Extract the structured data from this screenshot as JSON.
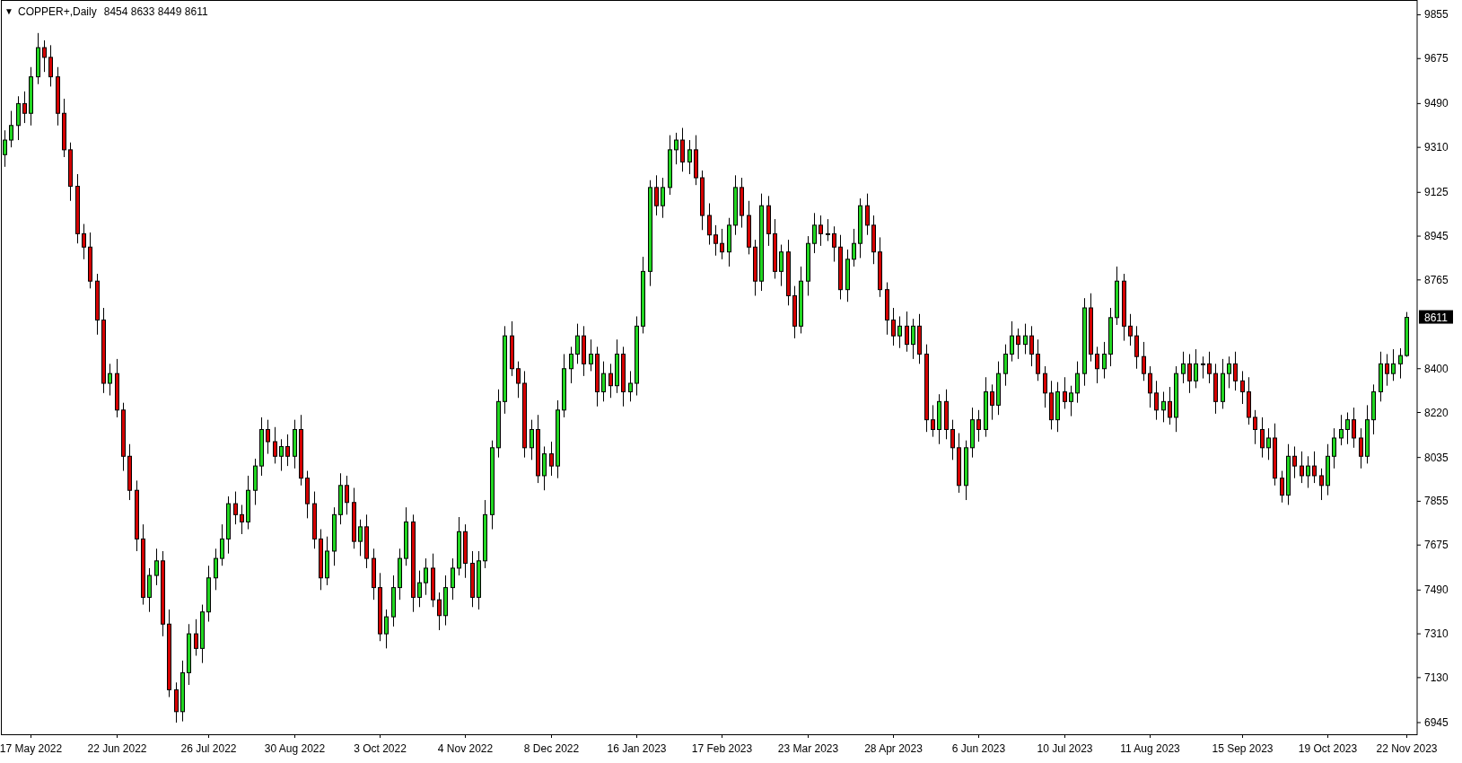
{
  "header": {
    "menu_glyph": "▼",
    "symbol": "COPPER+,Daily",
    "ohlc": [
      "8454",
      "8633",
      "8449",
      "8611"
    ]
  },
  "current_price_label": "8611",
  "chart_data": {
    "type": "candlestick",
    "ylim": [
      6897,
      9914
    ],
    "yticks": [
      {
        "value": 9855,
        "label": "9855"
      },
      {
        "value": 9675,
        "label": "9675"
      },
      {
        "value": 9490,
        "label": "9490"
      },
      {
        "value": 9310,
        "label": "9310"
      },
      {
        "value": 9125,
        "label": "9125"
      },
      {
        "value": 8945,
        "label": "8945"
      },
      {
        "value": 8765,
        "label": "8765"
      },
      {
        "value": 8400,
        "label": "8400"
      },
      {
        "value": 8220,
        "label": "8220"
      },
      {
        "value": 8035,
        "label": "8035"
      },
      {
        "value": 7855,
        "label": "7855"
      },
      {
        "value": 7675,
        "label": "7675"
      },
      {
        "value": 7490,
        "label": "7490"
      },
      {
        "value": 7310,
        "label": "7310"
      },
      {
        "value": 7130,
        "label": "7130"
      },
      {
        "value": 6945,
        "label": "6945"
      }
    ],
    "categories": [
      null,
      null,
      null,
      null,
      "17 May 2022",
      null,
      null,
      null,
      null,
      null,
      null,
      null,
      null,
      null,
      null,
      null,
      null,
      "22 Jun 2022",
      null,
      null,
      null,
      null,
      null,
      null,
      null,
      null,
      null,
      null,
      null,
      null,
      null,
      "26 Jul 2022",
      null,
      null,
      null,
      null,
      null,
      null,
      null,
      null,
      null,
      null,
      null,
      null,
      "30 Aug 2022",
      null,
      null,
      null,
      null,
      null,
      null,
      null,
      null,
      null,
      null,
      null,
      null,
      "3 Oct 2022",
      null,
      null,
      null,
      null,
      null,
      null,
      null,
      null,
      null,
      null,
      null,
      null,
      "4 Nov 2022",
      null,
      null,
      null,
      null,
      null,
      null,
      null,
      null,
      null,
      null,
      null,
      null,
      "8 Dec 2022",
      null,
      null,
      null,
      null,
      null,
      null,
      null,
      null,
      null,
      null,
      null,
      null,
      "16 Jan 2023",
      null,
      null,
      null,
      null,
      null,
      null,
      null,
      null,
      null,
      null,
      null,
      null,
      "17 Feb 2023",
      null,
      null,
      null,
      null,
      null,
      null,
      null,
      null,
      null,
      null,
      null,
      null,
      "23 Mar 2023",
      null,
      null,
      null,
      null,
      null,
      null,
      null,
      null,
      null,
      null,
      null,
      null,
      "28 Apr 2023",
      null,
      null,
      null,
      null,
      null,
      null,
      null,
      null,
      null,
      null,
      null,
      null,
      "6 Jun 2023",
      null,
      null,
      null,
      null,
      null,
      null,
      null,
      null,
      null,
      null,
      null,
      null,
      "10 Jul 2023",
      null,
      null,
      null,
      null,
      null,
      null,
      null,
      null,
      null,
      null,
      null,
      null,
      "11 Aug 2023",
      null,
      null,
      null,
      null,
      null,
      null,
      null,
      null,
      null,
      null,
      null,
      null,
      null,
      "15 Sep 2023",
      null,
      null,
      null,
      null,
      null,
      null,
      null,
      null,
      null,
      null,
      null,
      null,
      "19 Oct 2023",
      null,
      null,
      null,
      null,
      null,
      null,
      null,
      null,
      null,
      null,
      null,
      "22 Nov 2023"
    ],
    "ohlc": [
      [
        9280,
        9380,
        9230,
        9340
      ],
      [
        9340,
        9460,
        9310,
        9400
      ],
      [
        9400,
        9520,
        9340,
        9490
      ],
      [
        9490,
        9540,
        9410,
        9450
      ],
      [
        9450,
        9640,
        9400,
        9600
      ],
      [
        9600,
        9780,
        9570,
        9720
      ],
      [
        9720,
        9750,
        9620,
        9680
      ],
      [
        9680,
        9730,
        9560,
        9600
      ],
      [
        9600,
        9640,
        9400,
        9450
      ],
      [
        9450,
        9510,
        9270,
        9300
      ],
      [
        9300,
        9330,
        9090,
        9150
      ],
      [
        9150,
        9200,
        8915,
        8955
      ],
      [
        8955,
        8995,
        8850,
        8900
      ],
      [
        8900,
        8960,
        8730,
        8760
      ],
      [
        8760,
        8790,
        8540,
        8600
      ],
      [
        8600,
        8650,
        8300,
        8340
      ],
      [
        8340,
        8420,
        8290,
        8380
      ],
      [
        8380,
        8440,
        8200,
        8230
      ],
      [
        8230,
        8260,
        7980,
        8040
      ],
      [
        8040,
        8090,
        7860,
        7900
      ],
      [
        7900,
        7940,
        7650,
        7700
      ],
      [
        7700,
        7760,
        7430,
        7460
      ],
      [
        7460,
        7580,
        7400,
        7550
      ],
      [
        7550,
        7660,
        7510,
        7610
      ],
      [
        7610,
        7650,
        7300,
        7350
      ],
      [
        7350,
        7410,
        7050,
        7080
      ],
      [
        7080,
        7110,
        6945,
        6990
      ],
      [
        6990,
        7200,
        6950,
        7150
      ],
      [
        7150,
        7350,
        7100,
        7310
      ],
      [
        7310,
        7370,
        7220,
        7250
      ],
      [
        7250,
        7430,
        7190,
        7400
      ],
      [
        7400,
        7590,
        7360,
        7540
      ],
      [
        7540,
        7660,
        7490,
        7620
      ],
      [
        7620,
        7760,
        7590,
        7700
      ],
      [
        7700,
        7875,
        7640,
        7845
      ],
      [
        7845,
        7895,
        7760,
        7800
      ],
      [
        7800,
        7840,
        7720,
        7770
      ],
      [
        7770,
        7960,
        7740,
        7900
      ],
      [
        7900,
        8030,
        7840,
        8000
      ],
      [
        8000,
        8200,
        7960,
        8150
      ],
      [
        8150,
        8190,
        8050,
        8100
      ],
      [
        8100,
        8160,
        8010,
        8040
      ],
      [
        8040,
        8110,
        7980,
        8080
      ],
      [
        8080,
        8130,
        8000,
        8040
      ],
      [
        8040,
        8190,
        7990,
        8150
      ],
      [
        8150,
        8210,
        7920,
        7950
      ],
      [
        7950,
        7980,
        7785,
        7845
      ],
      [
        7845,
        7895,
        7660,
        7700
      ],
      [
        7700,
        7740,
        7490,
        7540
      ],
      [
        7540,
        7710,
        7510,
        7650
      ],
      [
        7650,
        7830,
        7590,
        7800
      ],
      [
        7800,
        7970,
        7760,
        7920
      ],
      [
        7920,
        7960,
        7800,
        7850
      ],
      [
        7850,
        7910,
        7660,
        7690
      ],
      [
        7690,
        7780,
        7630,
        7750
      ],
      [
        7750,
        7800,
        7580,
        7620
      ],
      [
        7620,
        7660,
        7450,
        7500
      ],
      [
        7500,
        7560,
        7280,
        7310
      ],
      [
        7310,
        7410,
        7250,
        7380
      ],
      [
        7380,
        7550,
        7340,
        7500
      ],
      [
        7500,
        7660,
        7450,
        7620
      ],
      [
        7620,
        7830,
        7590,
        7770
      ],
      [
        7770,
        7800,
        7400,
        7460
      ],
      [
        7460,
        7570,
        7420,
        7520
      ],
      [
        7520,
        7620,
        7470,
        7580
      ],
      [
        7580,
        7640,
        7420,
        7450
      ],
      [
        7450,
        7480,
        7325,
        7385
      ],
      [
        7385,
        7550,
        7345,
        7500
      ],
      [
        7500,
        7620,
        7450,
        7580
      ],
      [
        7580,
        7790,
        7550,
        7730
      ],
      [
        7730,
        7760,
        7540,
        7600
      ],
      [
        7600,
        7650,
        7420,
        7460
      ],
      [
        7460,
        7650,
        7410,
        7610
      ],
      [
        7610,
        7860,
        7580,
        7800
      ],
      [
        7800,
        8105,
        7740,
        8075
      ],
      [
        8075,
        8315,
        8035,
        8265
      ],
      [
        8265,
        8575,
        8215,
        8535
      ],
      [
        8535,
        8595,
        8370,
        8400
      ],
      [
        8400,
        8430,
        8280,
        8340
      ],
      [
        8340,
        8390,
        8035,
        8075
      ],
      [
        8075,
        8190,
        8025,
        8150
      ],
      [
        8150,
        8210,
        7930,
        7960
      ],
      [
        7960,
        8080,
        7900,
        8050
      ],
      [
        8050,
        8100,
        7960,
        8000
      ],
      [
        8000,
        8270,
        7950,
        8230
      ],
      [
        8230,
        8460,
        8200,
        8400
      ],
      [
        8400,
        8490,
        8340,
        8460
      ],
      [
        8460,
        8585,
        8420,
        8535
      ],
      [
        8535,
        8575,
        8370,
        8420
      ],
      [
        8420,
        8520,
        8390,
        8460
      ],
      [
        8460,
        8490,
        8245,
        8305
      ],
      [
        8305,
        8430,
        8265,
        8380
      ],
      [
        8380,
        8420,
        8280,
        8330
      ],
      [
        8330,
        8520,
        8300,
        8460
      ],
      [
        8460,
        8490,
        8245,
        8305
      ],
      [
        8305,
        8390,
        8265,
        8340
      ],
      [
        8340,
        8615,
        8290,
        8575
      ],
      [
        8575,
        8860,
        8545,
        8800
      ],
      [
        8800,
        9175,
        8740,
        9145
      ],
      [
        9145,
        9195,
        9030,
        9070
      ],
      [
        9070,
        9185,
        9020,
        9145
      ],
      [
        9145,
        9360,
        9115,
        9300
      ],
      [
        9300,
        9370,
        9240,
        9340
      ],
      [
        9340,
        9390,
        9210,
        9250
      ],
      [
        9250,
        9340,
        9200,
        9300
      ],
      [
        9300,
        9360,
        9155,
        9185
      ],
      [
        9185,
        9215,
        8970,
        9030
      ],
      [
        9030,
        9080,
        8910,
        8950
      ],
      [
        8950,
        8990,
        8865,
        8915
      ],
      [
        8915,
        8975,
        8850,
        8880
      ],
      [
        8880,
        9020,
        8820,
        8990
      ],
      [
        8990,
        9195,
        8950,
        9145
      ],
      [
        9145,
        9185,
        8980,
        9030
      ],
      [
        9030,
        9090,
        8870,
        8900
      ],
      [
        8900,
        8930,
        8700,
        8760
      ],
      [
        8760,
        9120,
        8720,
        9070
      ],
      [
        9070,
        9110,
        8905,
        8955
      ],
      [
        8955,
        9015,
        8770,
        8800
      ],
      [
        8800,
        8910,
        8740,
        8880
      ],
      [
        8880,
        8930,
        8660,
        8700
      ],
      [
        8700,
        8740,
        8525,
        8575
      ],
      [
        8575,
        8820,
        8545,
        8760
      ],
      [
        8760,
        8945,
        8700,
        8915
      ],
      [
        8915,
        9040,
        8875,
        8990
      ],
      [
        8990,
        9030,
        8905,
        8955
      ],
      [
        8955,
        9015,
        8925,
        8955
      ],
      [
        8955,
        8985,
        8840,
        8900
      ],
      [
        8900,
        8950,
        8685,
        8725
      ],
      [
        8725,
        8890,
        8675,
        8850
      ],
      [
        8850,
        8975,
        8820,
        8915
      ],
      [
        8915,
        9100,
        8855,
        9070
      ],
      [
        9070,
        9120,
        8950,
        8990
      ],
      [
        8990,
        9030,
        8830,
        8880
      ],
      [
        8880,
        8940,
        8695,
        8725
      ],
      [
        8725,
        8755,
        8540,
        8600
      ],
      [
        8600,
        8650,
        8495,
        8535
      ],
      [
        8535,
        8615,
        8485,
        8575
      ],
      [
        8575,
        8635,
        8470,
        8500
      ],
      [
        8500,
        8605,
        8440,
        8575
      ],
      [
        8575,
        8625,
        8420,
        8460
      ],
      [
        8460,
        8500,
        8140,
        8190
      ],
      [
        8190,
        8250,
        8120,
        8150
      ],
      [
        8150,
        8295,
        8090,
        8265
      ],
      [
        8265,
        8315,
        8110,
        8150
      ],
      [
        8150,
        8190,
        8025,
        8075
      ],
      [
        8075,
        8135,
        7890,
        7920
      ],
      [
        7920,
        8105,
        7860,
        8075
      ],
      [
        8075,
        8240,
        8035,
        8190
      ],
      [
        8190,
        8230,
        8100,
        8150
      ],
      [
        8150,
        8365,
        8120,
        8305
      ],
      [
        8305,
        8335,
        8190,
        8250
      ],
      [
        8250,
        8430,
        8210,
        8380
      ],
      [
        8380,
        8500,
        8330,
        8460
      ],
      [
        8460,
        8595,
        8430,
        8535
      ],
      [
        8535,
        8565,
        8440,
        8500
      ],
      [
        8500,
        8585,
        8460,
        8535
      ],
      [
        8535,
        8575,
        8410,
        8460
      ],
      [
        8460,
        8520,
        8350,
        8380
      ],
      [
        8380,
        8410,
        8240,
        8300
      ],
      [
        8300,
        8350,
        8150,
        8190
      ],
      [
        8190,
        8345,
        8140,
        8305
      ],
      [
        8305,
        8365,
        8235,
        8265
      ],
      [
        8265,
        8330,
        8205,
        8300
      ],
      [
        8300,
        8430,
        8260,
        8380
      ],
      [
        8380,
        8690,
        8330,
        8650
      ],
      [
        8650,
        8710,
        8430,
        8460
      ],
      [
        8460,
        8490,
        8340,
        8400
      ],
      [
        8400,
        8510,
        8360,
        8460
      ],
      [
        8460,
        8650,
        8410,
        8610
      ],
      [
        8610,
        8820,
        8580,
        8760
      ],
      [
        8760,
        8790,
        8515,
        8575
      ],
      [
        8575,
        8625,
        8495,
        8535
      ],
      [
        8535,
        8575,
        8400,
        8450
      ],
      [
        8450,
        8510,
        8350,
        8380
      ],
      [
        8380,
        8410,
        8240,
        8300
      ],
      [
        8300,
        8350,
        8190,
        8230
      ],
      [
        8230,
        8305,
        8180,
        8265
      ],
      [
        8265,
        8325,
        8170,
        8200
      ],
      [
        8200,
        8410,
        8140,
        8380
      ],
      [
        8380,
        8470,
        8340,
        8420
      ],
      [
        8420,
        8460,
        8300,
        8350
      ],
      [
        8350,
        8480,
        8320,
        8420
      ],
      [
        8420,
        8450,
        8360,
        8420
      ],
      [
        8420,
        8470,
        8340,
        8380
      ],
      [
        8380,
        8420,
        8215,
        8265
      ],
      [
        8265,
        8440,
        8235,
        8380
      ],
      [
        8380,
        8450,
        8320,
        8420
      ],
      [
        8420,
        8470,
        8310,
        8350
      ],
      [
        8350,
        8390,
        8255,
        8305
      ],
      [
        8305,
        8365,
        8170,
        8200
      ],
      [
        8200,
        8230,
        8090,
        8150
      ],
      [
        8150,
        8200,
        8035,
        8075
      ],
      [
        8075,
        8155,
        8025,
        8115
      ],
      [
        8115,
        8175,
        7920,
        7950
      ],
      [
        7950,
        7980,
        7850,
        7880
      ],
      [
        7880,
        8090,
        7840,
        8040
      ],
      [
        8040,
        8080,
        7950,
        8000
      ],
      [
        8000,
        8060,
        7930,
        7960
      ],
      [
        7960,
        8040,
        7910,
        8000
      ],
      [
        8000,
        8060,
        7930,
        7960
      ],
      [
        7960,
        7990,
        7860,
        7920
      ],
      [
        7920,
        8090,
        7880,
        8040
      ],
      [
        8040,
        8155,
        7990,
        8115
      ],
      [
        8115,
        8210,
        8085,
        8150
      ],
      [
        8150,
        8220,
        8090,
        8190
      ],
      [
        8190,
        8240,
        8075,
        8115
      ],
      [
        8115,
        8155,
        7990,
        8040
      ],
      [
        8040,
        8250,
        8010,
        8190
      ],
      [
        8190,
        8335,
        8130,
        8305
      ],
      [
        8305,
        8470,
        8265,
        8420
      ],
      [
        8420,
        8460,
        8330,
        8380
      ],
      [
        8380,
        8480,
        8350,
        8420
      ],
      [
        8420,
        8484,
        8360,
        8454
      ],
      [
        8454,
        8633,
        8449,
        8611
      ]
    ]
  }
}
